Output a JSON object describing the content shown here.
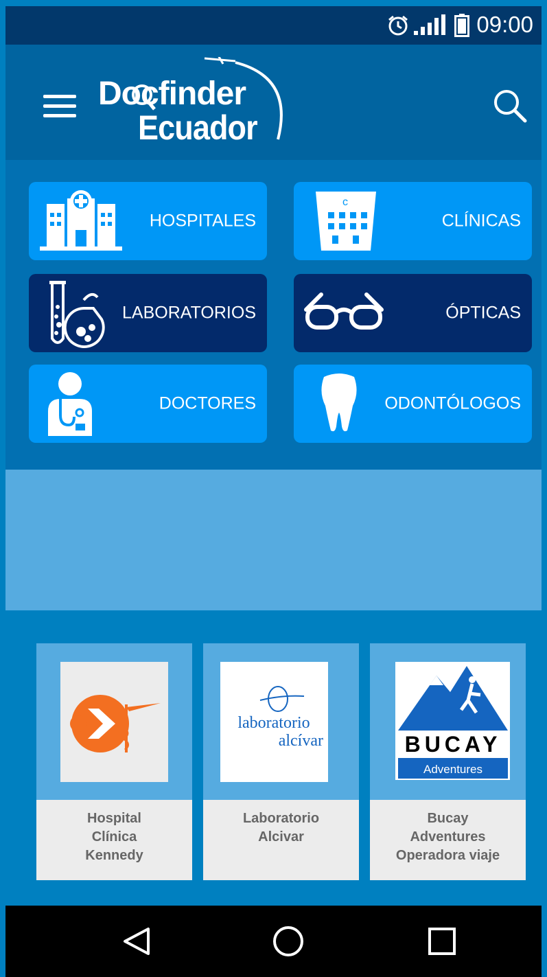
{
  "status": {
    "time": "09:00",
    "alarm_icon": "alarm-icon",
    "signal_icon": "signal-icon",
    "battery_icon": "battery-icon"
  },
  "appbar": {
    "logo_line1": "Docfinder",
    "logo_line2": "Ecuador",
    "menu_icon": "hamburger-menu-icon",
    "search_icon": "search-icon"
  },
  "categories": [
    {
      "label": "HOSPITALES",
      "icon": "hospital-icon",
      "style": "light"
    },
    {
      "label": "CLÍNICAS",
      "icon": "clinic-building-icon",
      "style": "light"
    },
    {
      "label": "LABORATORIOS",
      "icon": "lab-flask-icon",
      "style": "dark"
    },
    {
      "label": "ÓPTICAS",
      "icon": "glasses-icon",
      "style": "dark"
    },
    {
      "label": "DOCTORES",
      "icon": "doctor-icon",
      "style": "light"
    },
    {
      "label": "ODONTÓLOGOS",
      "icon": "tooth-icon",
      "style": "light"
    }
  ],
  "featured": [
    {
      "lines": [
        "Hospital",
        "Clínica",
        "Kennedy"
      ],
      "logo": "kennedy-logo"
    },
    {
      "lines": [
        "Laboratorio",
        "Alcivar"
      ],
      "logo": "alcivar-logo",
      "logo_text": [
        "laboratorio",
        "alcívar"
      ]
    },
    {
      "lines": [
        "Bucay",
        "Adventures",
        "Operadora viaje"
      ],
      "logo": "bucay-logo",
      "logo_text": [
        "BUCAY",
        "Adventures"
      ]
    }
  ],
  "colors": {
    "statusbar": "#02386b",
    "appbar": "#0164a0",
    "tile_light": "#0097f6",
    "tile_dark": "#032a6b",
    "banner": "#56abe0",
    "accent_orange": "#f36f21"
  }
}
